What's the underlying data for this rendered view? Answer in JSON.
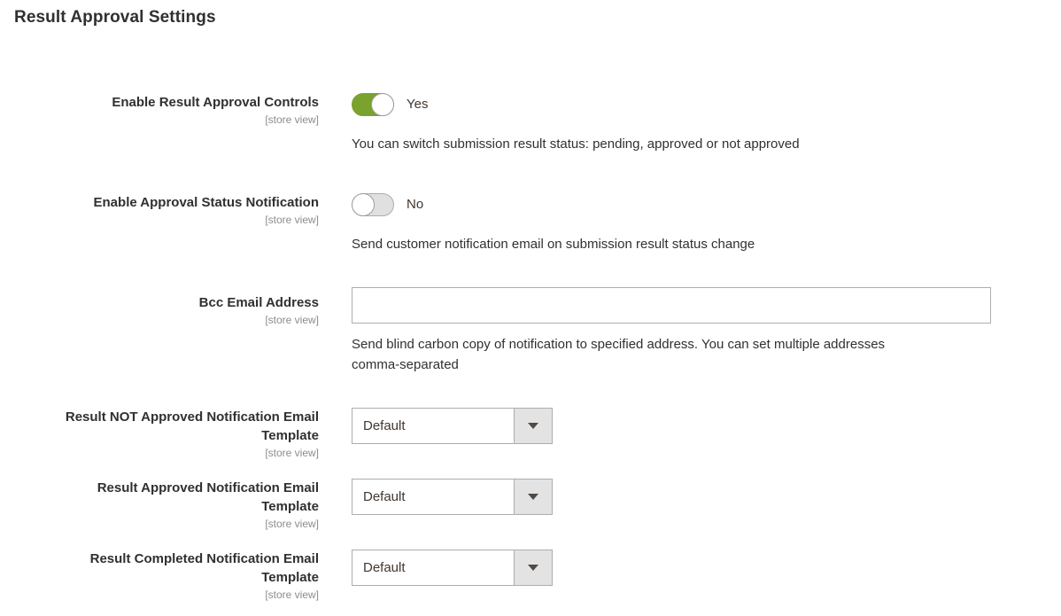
{
  "section": {
    "title": "Result Approval Settings"
  },
  "scope_label": "[store view]",
  "fields": [
    {
      "label": "Enable Result Approval Controls",
      "scope": "[store view]",
      "type": "toggle",
      "value": "Yes",
      "state": "on",
      "hint": "You can switch submission result status: pending, approved or not approved"
    },
    {
      "label": "Enable Approval Status Notification",
      "scope": "[store view]",
      "type": "toggle",
      "value": "No",
      "state": "off",
      "hint": "Send customer notification email on submission result status change"
    },
    {
      "label": "Bcc Email Address",
      "scope": "[store view]",
      "type": "text",
      "value": "",
      "placeholder": "",
      "hint": "Send blind carbon copy of notification to specified address. You can set multiple addresses comma-separated"
    },
    {
      "label_line1": "Result NOT Approved Notification Email",
      "label_line2": "Template",
      "scope": "[store view]",
      "type": "select",
      "value": "Default"
    },
    {
      "label_line1": "Result Approved Notification Email",
      "label_line2": "Template",
      "scope": "[store view]",
      "type": "select",
      "value": "Default"
    },
    {
      "label_line1": "Result Completed Notification Email",
      "label_line2": "Template",
      "scope": "[store view]",
      "type": "select",
      "value": "Default"
    }
  ],
  "colors": {
    "toggle_on": "#79a22e",
    "toggle_off_track": "#e0e0e0",
    "border": "#adadad",
    "text": "#303030",
    "muted": "#8c8c8c",
    "select_button": "#e3e3e3"
  }
}
